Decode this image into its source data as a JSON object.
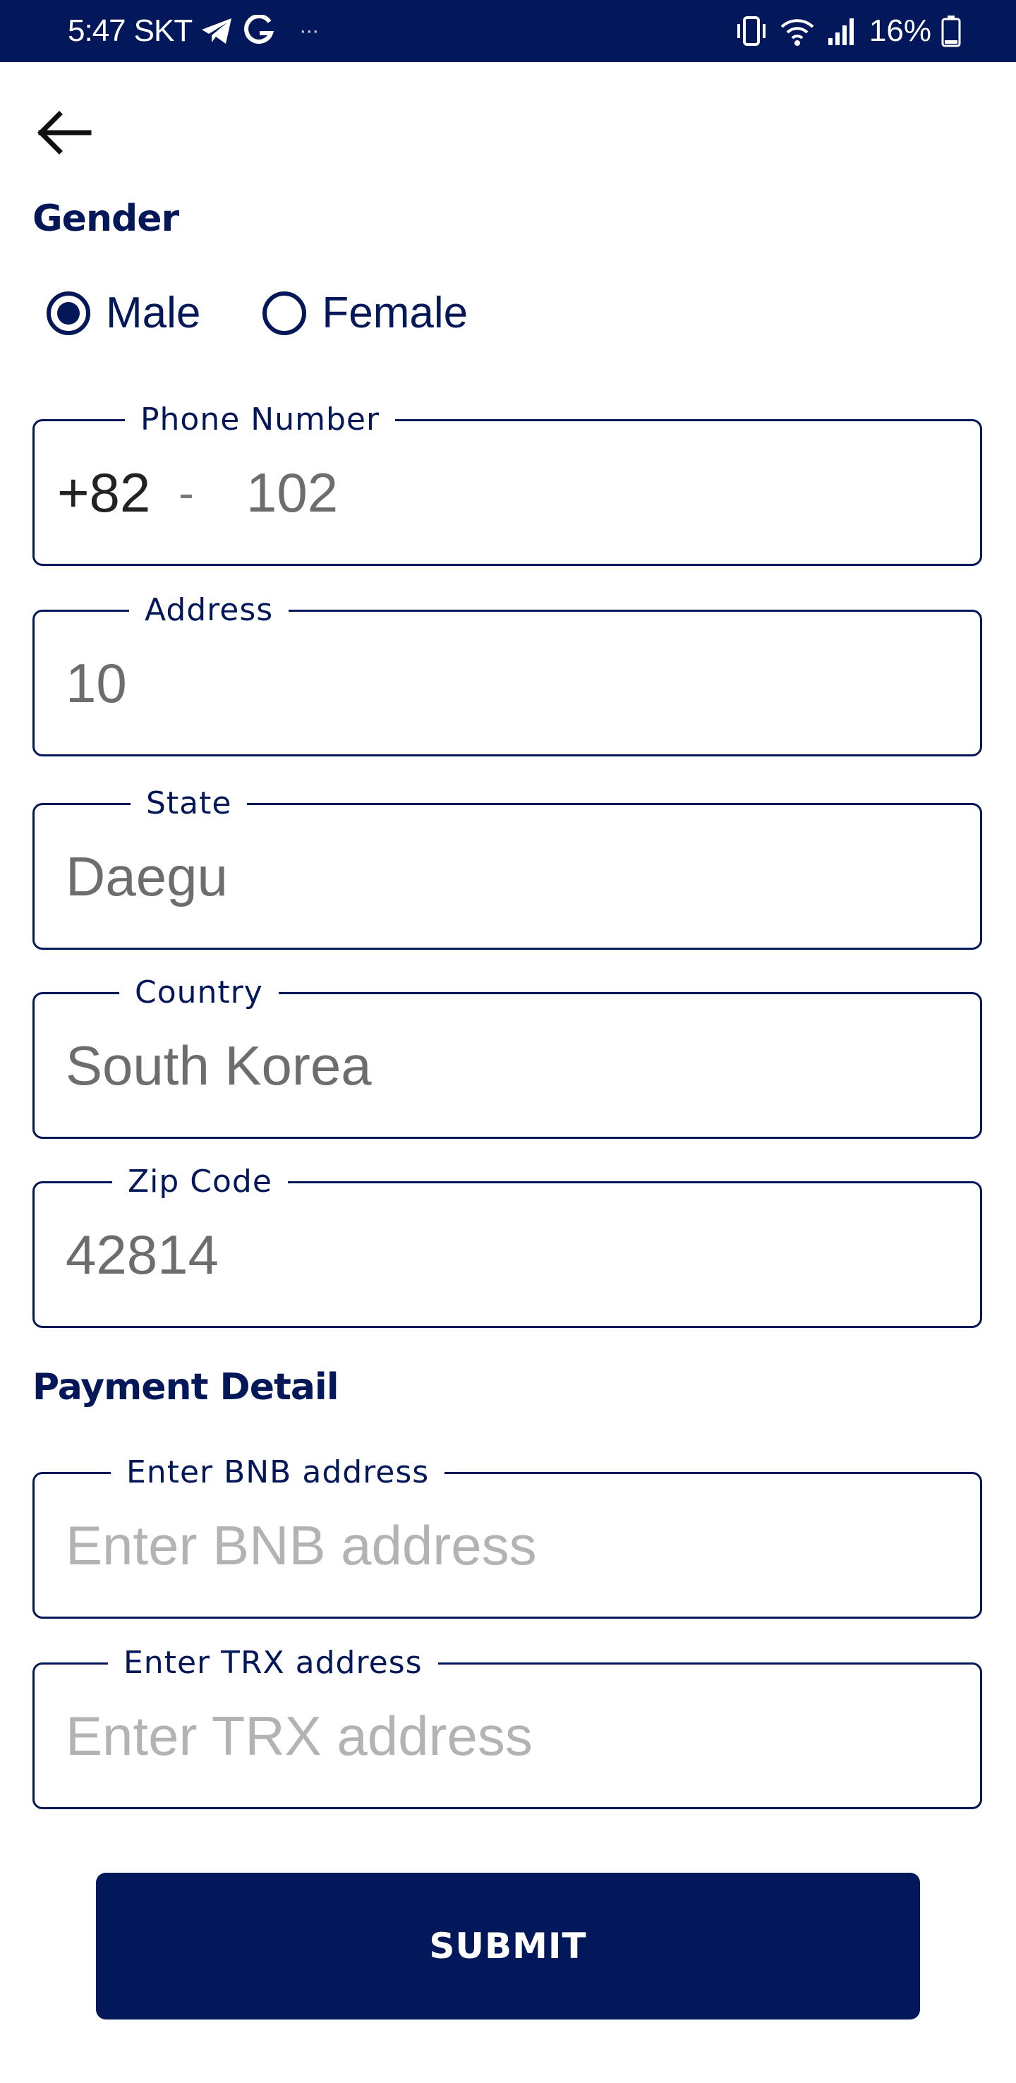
{
  "status_bar": {
    "time": "5:47",
    "carrier": "SKT",
    "more": "···",
    "battery": "16%",
    "icons": [
      "telegram-icon",
      "google-icon",
      "vibrate-icon",
      "wifi-icon",
      "signal-icon",
      "battery-icon"
    ]
  },
  "header": {
    "back_icon": "arrow-left-icon"
  },
  "gender": {
    "title": "Gender",
    "options": [
      {
        "label": "Male",
        "selected": true
      },
      {
        "label": "Female",
        "selected": false
      }
    ]
  },
  "phone": {
    "label": "Phone Number",
    "country_code": "+82",
    "separator": "-",
    "number": "102"
  },
  "address": {
    "label": "Address",
    "value": "10"
  },
  "state": {
    "label": "State",
    "value": "Daegu"
  },
  "country": {
    "label": "Country",
    "value": "South Korea"
  },
  "zip": {
    "label": "Zip Code",
    "value": "42814"
  },
  "payment": {
    "title": "Payment Detail",
    "bnb": {
      "label": "Enter BNB address",
      "placeholder": "Enter BNB address"
    },
    "trx": {
      "label": "Enter TRX address",
      "placeholder": "Enter TRX address"
    }
  },
  "submit_label": "SUBMIT",
  "colors": {
    "primary": "#03185a",
    "value_text": "#6d6d6d",
    "placeholder": "#b3b3b3"
  }
}
